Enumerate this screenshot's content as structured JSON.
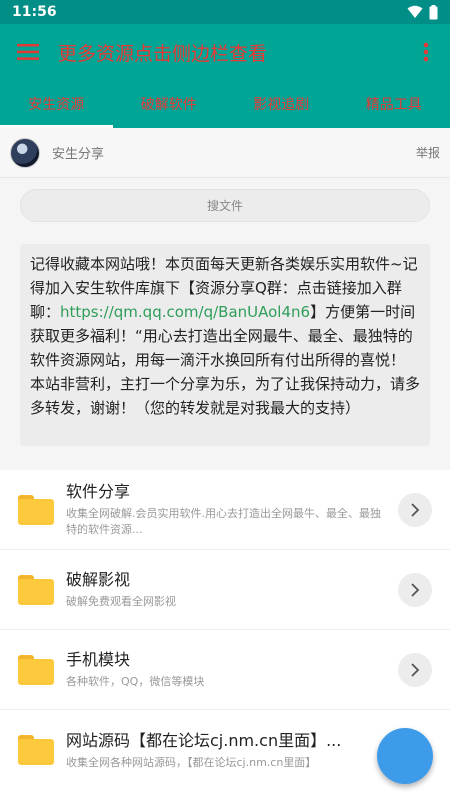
{
  "status": {
    "time": "11:56"
  },
  "appbar": {
    "title": "更多资源点击侧边栏查看"
  },
  "tabs": [
    {
      "label": "安生资源",
      "active": true
    },
    {
      "label": "破解软件",
      "active": false
    },
    {
      "label": "影视追剧",
      "active": false
    },
    {
      "label": "精品工具",
      "active": false
    }
  ],
  "author": {
    "name": "安生分享",
    "report_label": "举报"
  },
  "search": {
    "placeholder": "搜文件"
  },
  "notice": {
    "part1": "记得收藏本网站哦！本页面每天更新各类娱乐实用软件~记得加入安生软件库旗下【资源分享Q群：点击链接加入群聊：",
    "link": "https://qm.qq.com/q/BanUAol4n6",
    "part2": "】方便第一时间获取更多福利！“用心去打造出全网最牛、最全、最独特的软件资源网站，用每一滴汗水换回所有付出所得的喜悦！",
    "part3": "本站非营利，主打一个分享为乐，为了让我保持动力，请多多转发，谢谢！（您的转发就是对我最大的支持）"
  },
  "list": [
    {
      "title": "软件分享",
      "desc": "收集全网破解.会员实用软件.用心去打造出全网最牛、最全、最独特的软件资源..."
    },
    {
      "title": "破解影视",
      "desc": "破解免费观看全网影视"
    },
    {
      "title": "手机模块",
      "desc": "各种软件，QQ，微信等模块"
    },
    {
      "title": "网站源码【都在论坛cj.nm.cn里面】...",
      "desc": "收集全网各种网站源码，【都在论坛cj.nm.cn里面】"
    }
  ],
  "colors": {
    "primary": "#00a596",
    "accent_text": "#e53935",
    "fab": "#3d9be9",
    "link": "#2f9e5a",
    "folder": "#fcc93d"
  },
  "icons": {
    "menu": "hamburger-icon",
    "more": "more-vertical-icon",
    "chevron": "chevron-right-icon",
    "folder": "folder-icon",
    "wifi": "wifi-icon",
    "battery": "battery-icon"
  }
}
